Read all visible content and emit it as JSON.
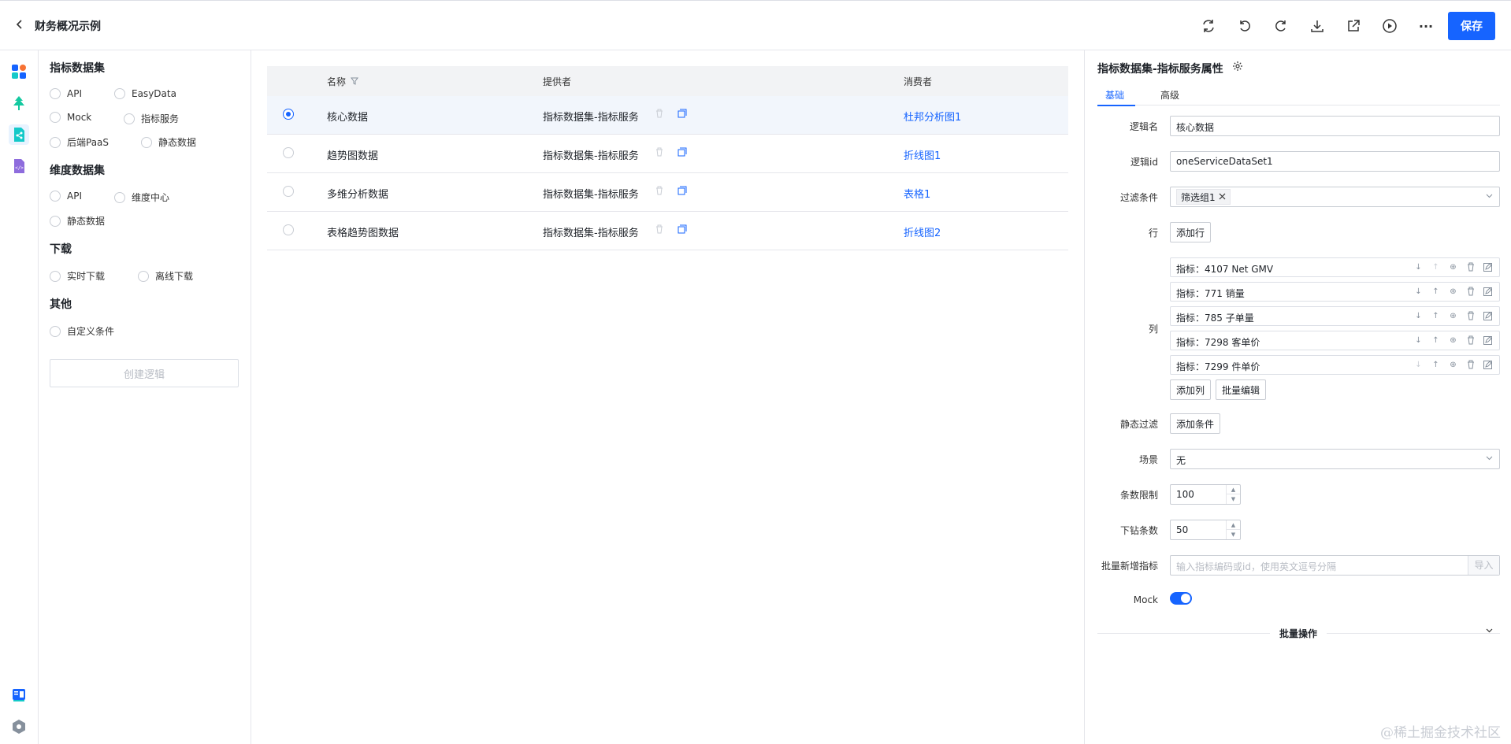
{
  "header": {
    "back_icon": "chevron-left-icon",
    "title": "财务概况示例",
    "toolbar_icons": [
      "sync-icon",
      "undo-icon",
      "redo-icon",
      "download-icon",
      "export-icon",
      "preview-icon",
      "more-icon"
    ],
    "more_text": "···",
    "save_label": "保存",
    "accent": "#1664ff"
  },
  "rail": {
    "icons": [
      "components-icon",
      "tree-icon",
      "dataset-icon",
      "code-icon",
      "book-icon",
      "settings-hexagon-icon"
    ],
    "active_index": 2
  },
  "palette": {
    "sections": [
      {
        "title": "指标数据集",
        "options": [
          "API",
          "EasyData",
          "Mock",
          "指标服务",
          "后端PaaS",
          "静态数据"
        ]
      },
      {
        "title": "维度数据集",
        "options": [
          "API",
          "维度中心",
          "静态数据"
        ]
      },
      {
        "title": "下载",
        "options": [
          "实时下载",
          "离线下载"
        ]
      },
      {
        "title": "其他",
        "options": [
          "自定义条件"
        ]
      }
    ],
    "create_label": "创建逻辑"
  },
  "table": {
    "headers": {
      "name": "名称",
      "provider": "提供者",
      "consumer": "消费者"
    },
    "rows": [
      {
        "name": "核心数据",
        "provider": "指标数据集-指标服务",
        "consumer": "杜邦分析图1",
        "selected": true
      },
      {
        "name": "趋势图数据",
        "provider": "指标数据集-指标服务",
        "consumer": "折线图1",
        "selected": false
      },
      {
        "name": "多维分析数据",
        "provider": "指标数据集-指标服务",
        "consumer": "表格1",
        "selected": false
      },
      {
        "name": "表格趋势图数据",
        "provider": "指标数据集-指标服务",
        "consumer": "折线图2",
        "selected": false
      }
    ]
  },
  "props": {
    "title": "指标数据集-指标服务属性",
    "tabs": [
      "基础",
      "高级"
    ],
    "active_tab": 0,
    "labels": {
      "logic_name": "逻辑名",
      "logic_id": "逻辑id",
      "filter": "过滤条件",
      "row": "行",
      "column": "列",
      "static_filter": "静态过滤",
      "scene": "场景",
      "limit": "条数限制",
      "drill_limit": "下钻条数",
      "batch_add": "批量新增指标",
      "mock": "Mock"
    },
    "logic_name_value": "核心数据",
    "logic_id_value": "oneServiceDataSet1",
    "filter_tag": "筛选组1",
    "add_row_label": "添加行",
    "columns": [
      "指标：4107 Net GMV",
      "指标：771 销量",
      "指标：785 子单量",
      "指标：7298 客单价",
      "指标：7299 件单价"
    ],
    "add_column_label": "添加列",
    "batch_edit_label": "批量编辑",
    "add_condition_label": "添加条件",
    "scene_value": "无",
    "limit_value": "100",
    "drill_limit_value": "50",
    "batch_add_placeholder": "输入指标编码或id，使用英文逗号分隔",
    "import_label": "导入",
    "mock_enabled": true,
    "batch_ops_label": "批量操作"
  },
  "watermark": "@稀土掘金技术社区"
}
